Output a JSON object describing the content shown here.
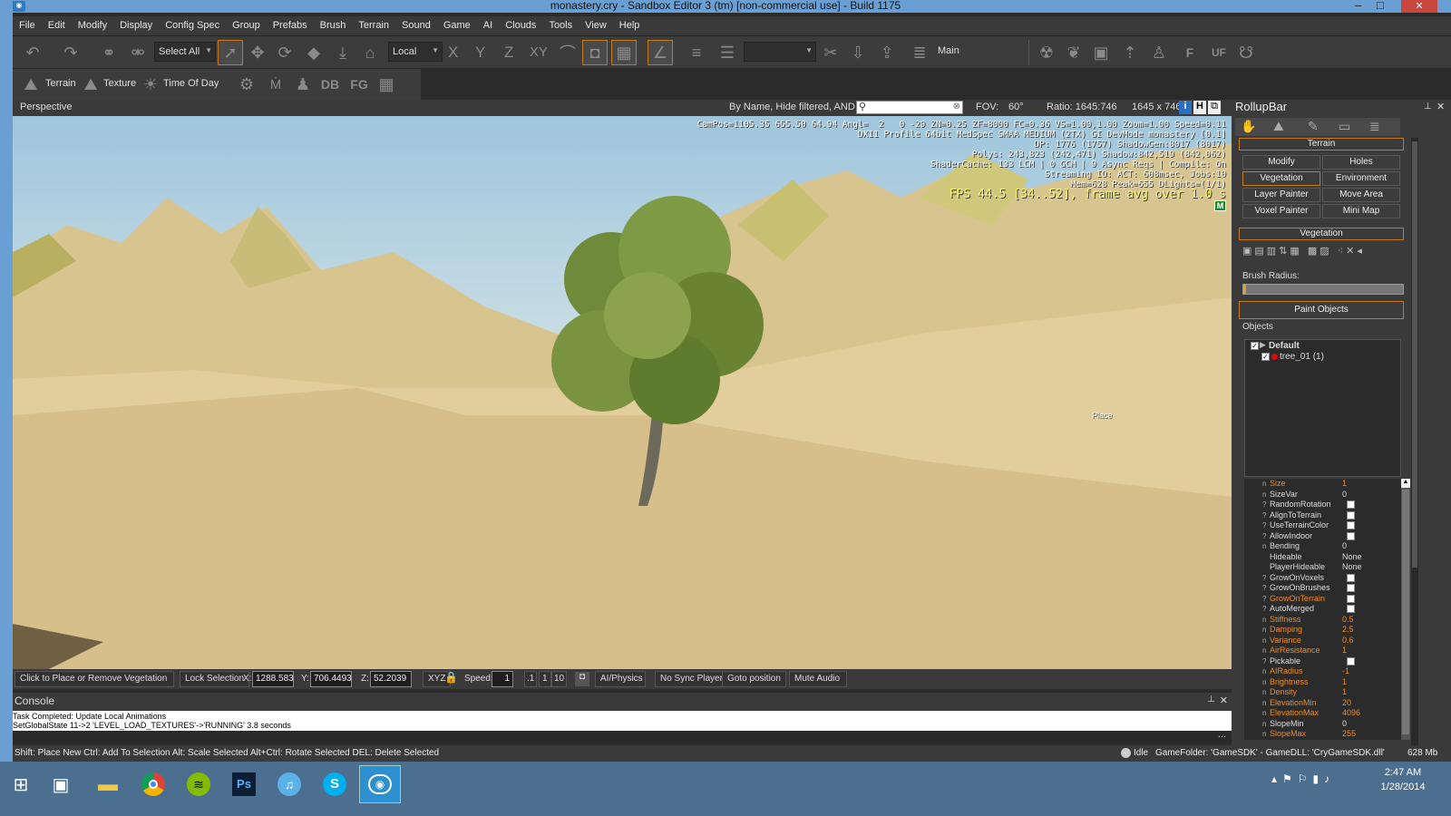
{
  "window": {
    "title": "monastery.cry - Sandbox Editor 3 (tm) [non-commercial use] - Build 1175"
  },
  "menu": [
    "File",
    "Edit",
    "Modify",
    "Display",
    "Config Spec",
    "Group",
    "Prefabs",
    "Brush",
    "Terrain",
    "Sound",
    "Game",
    "AI",
    "Clouds",
    "Tools",
    "View",
    "Help"
  ],
  "toolbar": {
    "select_all": "Select All",
    "coord_space": "Local",
    "axis_x": "X",
    "axis_y": "Y",
    "axis_z": "Z",
    "axis_xy": "XY",
    "main_label": "Main",
    "f_label": "F",
    "uf_label": "UF"
  },
  "toolbar2": {
    "terrain": "Terrain",
    "texture": "Texture",
    "time_of_day": "Time Of Day",
    "db": "DB",
    "fg": "FG"
  },
  "viewport_header": {
    "name": "Perspective",
    "filter": "By Name, Hide filtered, AND",
    "fov_label": "FOV:",
    "fov": "60°",
    "ratio_label": "Ratio: 1645:746",
    "size": "1645 x 746",
    "i": "i",
    "h": "H"
  },
  "overlay": {
    "line1": "CamPos=1105.35 655.50 64.94 Angl=  2   0 -29 ZN=0.25 ZF=8000 FC=0.36 VS=1.00,1.00 Zoom=1.00 Speed=0.11",
    "line2": "DX11 Profile 64bit MedSpec SMAA MEDIUM (2TX) GI DevMode monastery [0.1]",
    "line3": "DP: 1776 (1757) ShadowGen:8017 (8017)",
    "line4": "Polys: 243,823 (242,471) Shadow:842,519 (842,062)",
    "line5": "ShaderCache: 133 LCM | 0 GCM | 9 Async Reqs | Compile: On",
    "line6": "Streaming IO: ACT: 608msec, Jobs:10",
    "line7": "Mem=628 Peak=655 DLights=(1/1)",
    "fps": "FPS 44.5 [34..52], frame avg over 1.0 s",
    "m_badge": "M",
    "place": "Place"
  },
  "status_row": {
    "hint": "Click to Place or Remove Vegetation",
    "lock": "Lock Selection",
    "x_label": "X:",
    "x": "1288.583",
    "y_label": "Y:",
    "y": "706.4493",
    "z_label": "Z:",
    "z": "52.2039",
    "xyz": "XYZ",
    "speed_label": "Speed:",
    "speed": "1",
    "s1": ".1",
    "s2": "1",
    "s3": "10",
    "ai": "AI/Physics",
    "sync": "No Sync Player",
    "goto": "Goto position",
    "mute": "Mute Audio"
  },
  "console": {
    "title": "Console",
    "line1": "Task Completed: Update Local Animations",
    "line2": "SetGlobalState 11->2 'LEVEL_LOAD_TEXTURES'->'RUNNING' 3.8 seconds",
    "more": "..."
  },
  "hintbar": {
    "text": "Shift: Place New  Ctrl: Add To Selection  Alt: Scale Selected  Alt+Ctrl: Rotate Selected DEL: Delete Selected",
    "idle": "Idle",
    "gamefolder": "GameFolder: 'GameSDK' - GameDLL: 'CryGameSDK.dll'",
    "mem": "628 Mb"
  },
  "rollup": {
    "title": "RollupBar",
    "terrain": "Terrain",
    "modify": "Modify",
    "holes": "Holes",
    "vegetation_btn": "Vegetation",
    "environment": "Environment",
    "layer_painter": "Layer Painter",
    "move_area": "Move Area",
    "voxel_painter": "Voxel Painter",
    "mini_map": "Mini Map",
    "vegetation_section": "Vegetation",
    "brush_radius": "Brush Radius:",
    "paint_objects": "Paint Objects",
    "objects": "Objects",
    "tree_group": "Default",
    "tree_item": "tree_01 (1)"
  },
  "properties": [
    {
      "icon": "n",
      "name": "Size",
      "value": "1",
      "highlight": true
    },
    {
      "icon": "n",
      "name": "SizeVar",
      "value": "0",
      "highlight": false
    },
    {
      "icon": "?",
      "name": "RandomRotation",
      "value": "",
      "check": true,
      "highlight": false
    },
    {
      "icon": "?",
      "name": "AlignToTerrain",
      "value": "",
      "check": true,
      "highlight": false
    },
    {
      "icon": "?",
      "name": "UseTerrainColor",
      "value": "",
      "check": true,
      "highlight": false
    },
    {
      "icon": "?",
      "name": "AllowIndoor",
      "value": "",
      "check": true,
      "highlight": false
    },
    {
      "icon": "n",
      "name": "Bending",
      "value": "0",
      "highlight": false
    },
    {
      "icon": "",
      "name": "Hideable",
      "value": "None",
      "highlight": false
    },
    {
      "icon": "",
      "name": "PlayerHideable",
      "value": "None",
      "highlight": false
    },
    {
      "icon": "?",
      "name": "GrowOnVoxels",
      "value": "",
      "check": true,
      "highlight": false
    },
    {
      "icon": "?",
      "name": "GrowOnBrushes",
      "value": "",
      "check": true,
      "highlight": false
    },
    {
      "icon": "?",
      "name": "GrowOnTerrain",
      "value": "",
      "check": true,
      "highlight": true
    },
    {
      "icon": "?",
      "name": "AutoMerged",
      "value": "",
      "check": true,
      "highlight": false
    },
    {
      "icon": "n",
      "name": "Stiffness",
      "value": "0.5",
      "highlight": true
    },
    {
      "icon": "n",
      "name": "Damping",
      "value": "2.5",
      "highlight": true
    },
    {
      "icon": "n",
      "name": "Variance",
      "value": "0.6",
      "highlight": true
    },
    {
      "icon": "n",
      "name": "AirResistance",
      "value": "1",
      "highlight": true
    },
    {
      "icon": "?",
      "name": "Pickable",
      "value": "",
      "check": true,
      "highlight": false
    },
    {
      "icon": "n",
      "name": "AIRadius",
      "value": "-1",
      "highlight": true
    },
    {
      "icon": "n",
      "name": "Brightness",
      "value": "1",
      "highlight": true
    },
    {
      "icon": "n",
      "name": "Density",
      "value": "1",
      "highlight": true
    },
    {
      "icon": "n",
      "name": "ElevationMin",
      "value": "20",
      "highlight": true
    },
    {
      "icon": "n",
      "name": "ElevationMax",
      "value": "4096",
      "highlight": true
    },
    {
      "icon": "n",
      "name": "SlopeMin",
      "value": "0",
      "highlight": false
    },
    {
      "icon": "n",
      "name": "SlopeMax",
      "value": "255",
      "highlight": true
    }
  ],
  "taskbar": {
    "time": "2:47 AM",
    "date": "1/28/2014",
    "ps": "Ps"
  },
  "colors": {
    "accent": "#c87a1e",
    "orange_text": "#f08a24",
    "titlebar": "#6a9fd4",
    "taskbar": "#4c6f90"
  }
}
